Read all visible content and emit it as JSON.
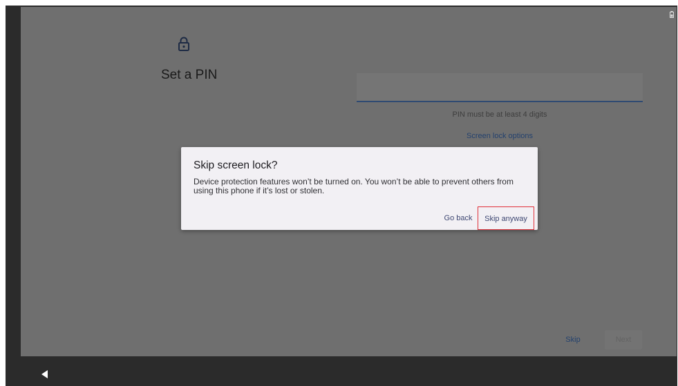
{
  "setup": {
    "title": "Set a PIN",
    "pin_input": {
      "value": "",
      "placeholder": ""
    },
    "pin_helper": "PIN must be at least 4 digits",
    "lock_options_link": "Screen lock options",
    "footer": {
      "skip_label": "Skip",
      "next_label": "Next"
    }
  },
  "dialog": {
    "title": "Skip screen lock?",
    "message_line1": "Device protection features won’t be turned on. You won’t be able to prevent others from",
    "message_line2": "using this phone if it’s lost or stolen.",
    "go_back_label": "Go back",
    "skip_anyway_label": "Skip anyway"
  },
  "icons": {
    "lock": "lock-icon",
    "battery": "battery-icon",
    "back": "back-triangle-icon"
  },
  "colors": {
    "accent": "#23416e",
    "highlight_border": "#e0303a",
    "dialog_bg": "#f2f0f4"
  }
}
